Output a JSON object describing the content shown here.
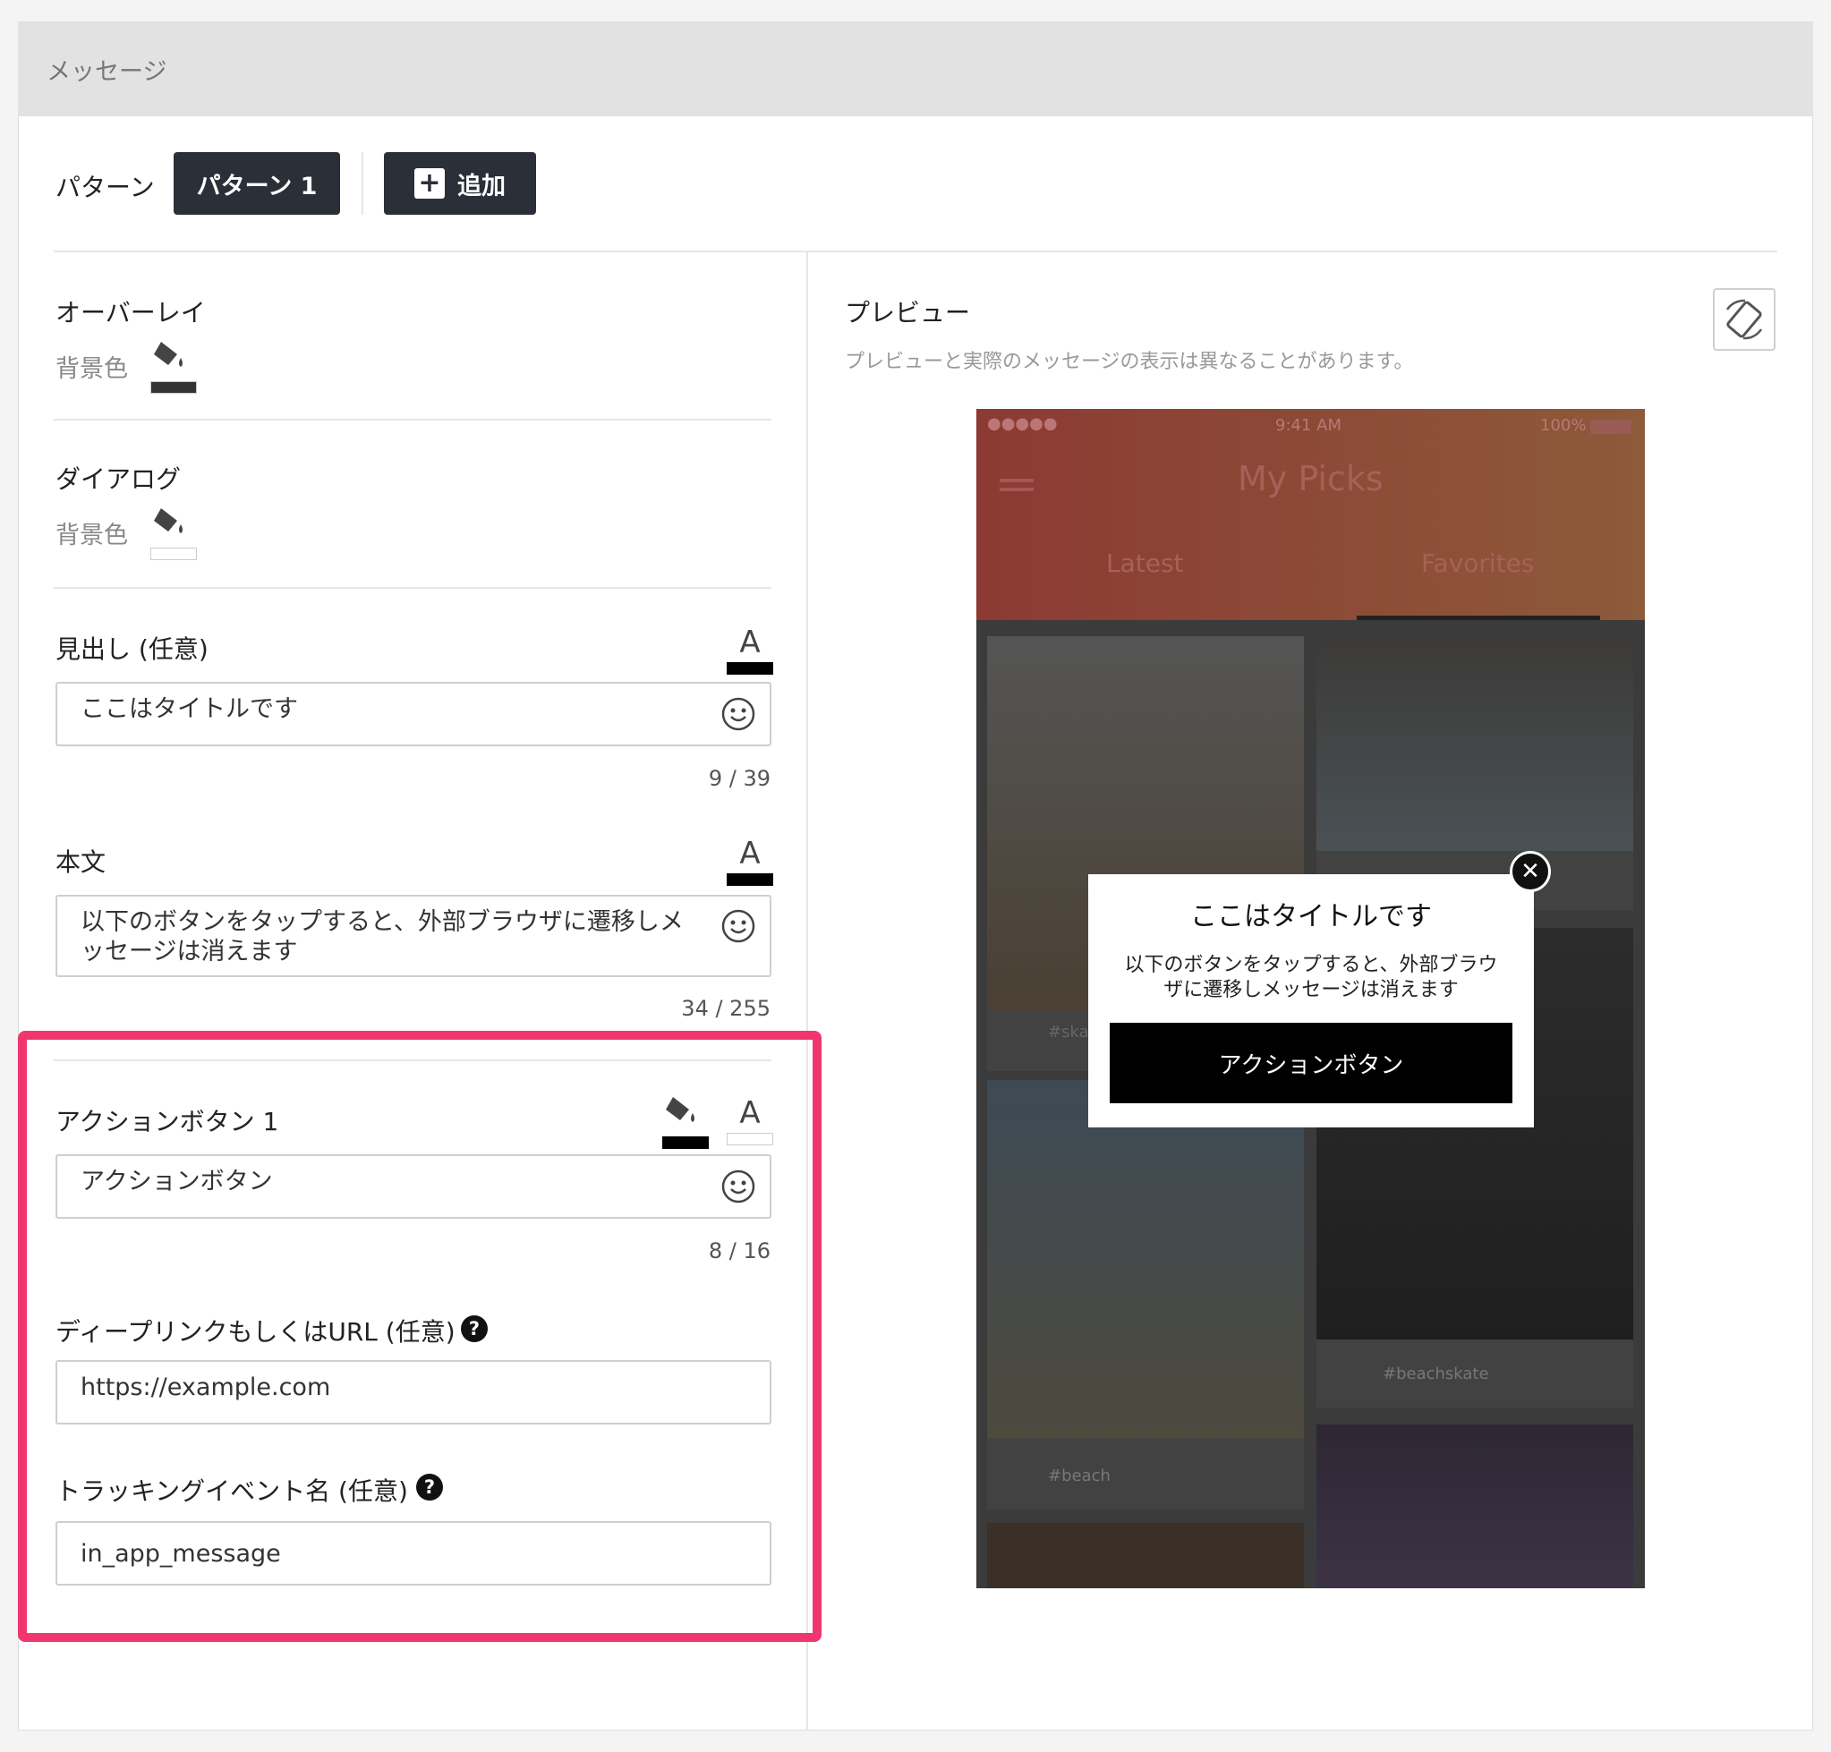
{
  "header": {
    "title": "メッセージ"
  },
  "pattern": {
    "label": "パターン",
    "active_tab": "パターン 1",
    "add_label": "追加"
  },
  "overlay": {
    "title": "オーバーレイ",
    "bg_label": "背景色",
    "bg_color": "#333333"
  },
  "dialog": {
    "title": "ダイアログ",
    "bg_label": "背景色",
    "bg_color": "#ffffff"
  },
  "heading": {
    "label": "見出し (任意)",
    "value": "ここはタイトルです",
    "counter": "9 / 39",
    "text_color": "#000000"
  },
  "body": {
    "label": "本文",
    "value": "以下のボタンをタップすると、外部ブラウザに遷移しメッセージは消えます",
    "counter": "34 / 255",
    "text_color": "#000000"
  },
  "action_button": {
    "label": "アクションボタン 1",
    "value": "アクションボタン",
    "counter": "8 / 16",
    "bg_color": "#000000",
    "text_color": "#ffffff"
  },
  "deeplink": {
    "label": "ディープリンクもしくはURL (任意)",
    "value": "https://example.com"
  },
  "tracking": {
    "label": "トラッキングイベント名 (任意)",
    "value": "in_app_message"
  },
  "preview": {
    "title": "プレビュー",
    "note": "プレビューと実際のメッセージの表示は異なることがあります。",
    "rotate_icon": "rotate-device-icon",
    "phone": {
      "time": "9:41 AM",
      "battery": "100%",
      "app_title": "My Picks",
      "tabs": [
        "Latest",
        "Favorites"
      ],
      "tags": [
        "#skat",
        "#beachskate",
        "#beach"
      ]
    },
    "dialog": {
      "title": "ここはタイトルです",
      "body": "以下のボタンをタップすると、外部ブラウザに遷移しメッセージは消えます",
      "button": "アクションボタン"
    }
  },
  "help_icon_glyph": "?",
  "icons": {
    "fill": "paint-bucket-icon",
    "text_color": "text-color-icon",
    "emoji": "emoji-icon",
    "help": "help-icon",
    "close": "close-icon",
    "plus": "plus-icon"
  },
  "accent_color": "#f0366f"
}
